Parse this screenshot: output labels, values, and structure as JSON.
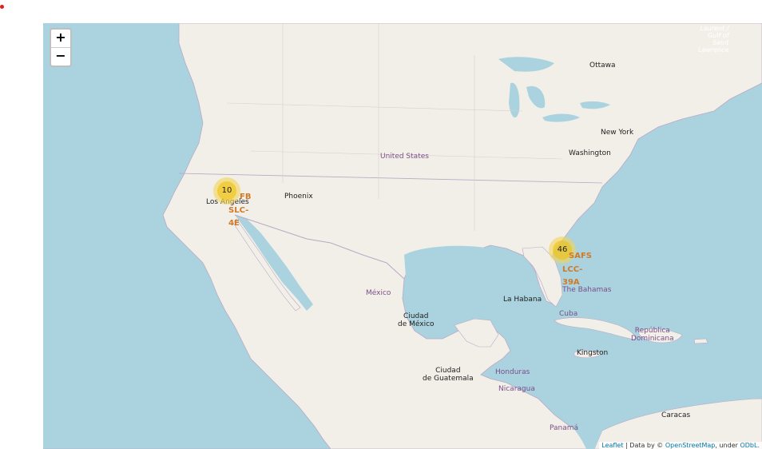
{
  "zoom": {
    "in_label": "+",
    "out_label": "−"
  },
  "labels": {
    "ottawa": "Ottawa",
    "new_york": "New York",
    "washington": "Washington",
    "united_states": "United States",
    "los_angeles": "Los Angeles",
    "phoenix": "Phoenix",
    "mexico": "México",
    "ciudad_mexico_1": "Ciudad",
    "ciudad_mexico_2": "de México",
    "la_habana": "La Habana",
    "cuba": "Cuba",
    "the_bahamas": "The Bahamas",
    "republica_1": "República",
    "republica_2": "Dominicana",
    "kingston": "Kingston",
    "guatemala_1": "Ciudad",
    "guatemala_2": "de Guatemala",
    "honduras": "Honduras",
    "nicaragua": "Nicaragua",
    "panama": "Panamá",
    "caracas": "Caracas",
    "gulf_1": "Laurent /",
    "gulf_2": "Gulf of",
    "gulf_3": "Saint",
    "gulf_4": "Lawrence"
  },
  "clusters": {
    "west": "10",
    "east": "46"
  },
  "markers": {
    "west_1": "FB",
    "west_2": "SLC-",
    "west_3": "4E",
    "east_1": "SAFS",
    "east_2": "LCC-",
    "east_3": "39A"
  },
  "attribution": {
    "leaflet": "Leaflet",
    "data_by": " | Data by © ",
    "osm": "OpenStreetMap",
    "under": ", under ",
    "odbl": "ODbL."
  },
  "colors": {
    "water": "#aad3df",
    "land": "#f2efe9",
    "cluster_outer": "#f1d357",
    "cluster_inner": "#f0c20c",
    "marker_text": "#d07a28"
  }
}
